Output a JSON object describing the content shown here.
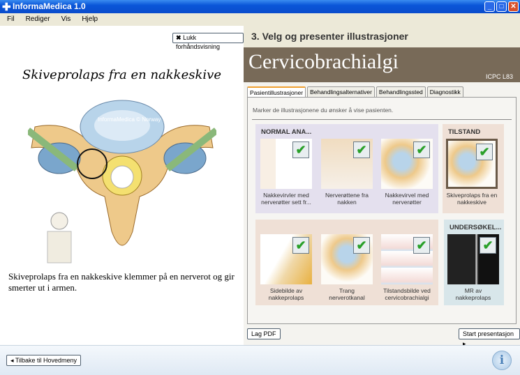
{
  "window": {
    "title": "InformaMedica 1.0"
  },
  "menu": [
    "Fil",
    "Rediger",
    "Vis",
    "Hjelp"
  ],
  "left": {
    "close_preview": "Lukk forhåndsvisning",
    "title": "Skiveprolaps fra en nakkeskive",
    "caption": "Skiveprolaps fra en nakkeskive klemmer på en nerverot og gir smerter ut i armen.",
    "watermark": "InformaMedica © Norway"
  },
  "right": {
    "step": "3. Velg og presenter illustrasjoner",
    "diagnosis": "Cervicobrachialgi",
    "code": "ICPC L83",
    "tabs": [
      "Pasientillustrasjoner",
      "Behandlingsalternativer",
      "Behandlingssted",
      "Diagnostikk"
    ],
    "instruction": "Marker de illustrasjonene du ønsker å vise pasienten.",
    "groups": {
      "normal": "NORMAL ANA...",
      "tilstand": "TILSTAND",
      "undersok": "UNDERSØKEL..."
    },
    "cards": [
      "Nakkevirvler med nerverøtter sett fr...",
      "Nerverøttene fra nakken",
      "Nakkevirvel med nerverøtter",
      "Skiveprolaps fra en nakkeskive",
      "Sidebilde av nakkeprolaps",
      "Trang nerverotkanal",
      "Tilstandsbilde ved cervicobrachialgi",
      "MR av nakkeprolaps"
    ],
    "check_glyph": "✔",
    "pdf": "Lag PDF",
    "start": "Start presentasjon"
  },
  "bottom": {
    "back": "Tilbake til Hovedmeny"
  }
}
